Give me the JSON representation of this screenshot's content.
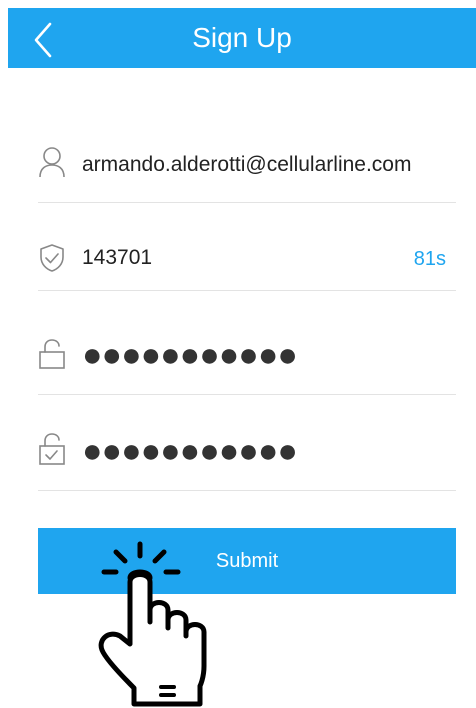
{
  "header": {
    "title": "Sign Up",
    "back_icon": "chevron-left-icon",
    "background": "#1fa5ef"
  },
  "form": {
    "email": {
      "icon": "user-icon",
      "value": "armando.alderotti@cellularline.com"
    },
    "verification_code": {
      "icon": "shield-check-icon",
      "value": "143701",
      "countdown": "81s"
    },
    "password": {
      "icon": "lock-icon",
      "value": "●●●●●●●●●●●"
    },
    "confirm_password": {
      "icon": "lock-check-icon",
      "value": "●●●●●●●●●●●"
    },
    "submit_label": "Submit"
  },
  "overlay": {
    "icon": "tap-hand-icon"
  },
  "colors": {
    "accent": "#1fa5ef",
    "divider": "#e3e3e3",
    "text": "#222222"
  }
}
